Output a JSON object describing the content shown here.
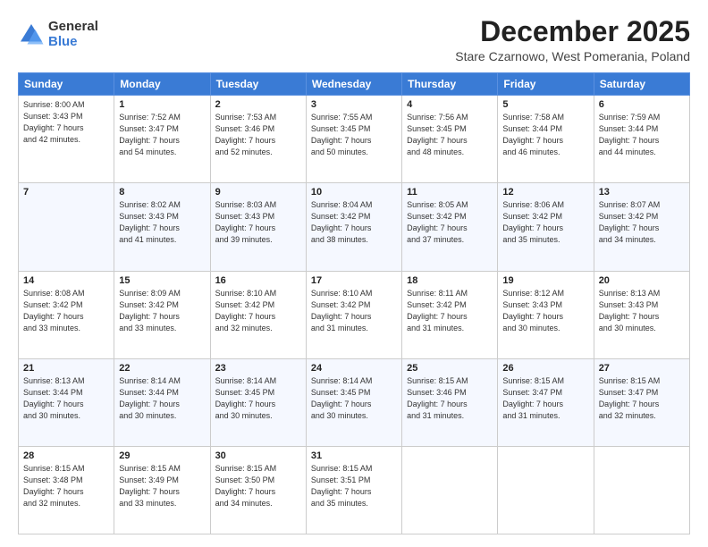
{
  "logo": {
    "general": "General",
    "blue": "Blue"
  },
  "header": {
    "title": "December 2025",
    "subtitle": "Stare Czarnowo, West Pomerania, Poland"
  },
  "weekdays": [
    "Sunday",
    "Monday",
    "Tuesday",
    "Wednesday",
    "Thursday",
    "Friday",
    "Saturday"
  ],
  "weeks": [
    [
      {
        "day": "",
        "info": ""
      },
      {
        "day": "1",
        "info": "Sunrise: 7:52 AM\nSunset: 3:47 PM\nDaylight: 7 hours\nand 54 minutes."
      },
      {
        "day": "2",
        "info": "Sunrise: 7:53 AM\nSunset: 3:46 PM\nDaylight: 7 hours\nand 52 minutes."
      },
      {
        "day": "3",
        "info": "Sunrise: 7:55 AM\nSunset: 3:45 PM\nDaylight: 7 hours\nand 50 minutes."
      },
      {
        "day": "4",
        "info": "Sunrise: 7:56 AM\nSunset: 3:45 PM\nDaylight: 7 hours\nand 48 minutes."
      },
      {
        "day": "5",
        "info": "Sunrise: 7:58 AM\nSunset: 3:44 PM\nDaylight: 7 hours\nand 46 minutes."
      },
      {
        "day": "6",
        "info": "Sunrise: 7:59 AM\nSunset: 3:44 PM\nDaylight: 7 hours\nand 44 minutes."
      }
    ],
    [
      {
        "day": "7",
        "info": ""
      },
      {
        "day": "8",
        "info": "Sunrise: 8:02 AM\nSunset: 3:43 PM\nDaylight: 7 hours\nand 41 minutes."
      },
      {
        "day": "9",
        "info": "Sunrise: 8:03 AM\nSunset: 3:43 PM\nDaylight: 7 hours\nand 39 minutes."
      },
      {
        "day": "10",
        "info": "Sunrise: 8:04 AM\nSunset: 3:42 PM\nDaylight: 7 hours\nand 38 minutes."
      },
      {
        "day": "11",
        "info": "Sunrise: 8:05 AM\nSunset: 3:42 PM\nDaylight: 7 hours\nand 37 minutes."
      },
      {
        "day": "12",
        "info": "Sunrise: 8:06 AM\nSunset: 3:42 PM\nDaylight: 7 hours\nand 35 minutes."
      },
      {
        "day": "13",
        "info": "Sunrise: 8:07 AM\nSunset: 3:42 PM\nDaylight: 7 hours\nand 34 minutes."
      }
    ],
    [
      {
        "day": "14",
        "info": ""
      },
      {
        "day": "15",
        "info": "Sunrise: 8:09 AM\nSunset: 3:42 PM\nDaylight: 7 hours\nand 33 minutes."
      },
      {
        "day": "16",
        "info": "Sunrise: 8:10 AM\nSunset: 3:42 PM\nDaylight: 7 hours\nand 32 minutes."
      },
      {
        "day": "17",
        "info": "Sunrise: 8:10 AM\nSunset: 3:42 PM\nDaylight: 7 hours\nand 31 minutes."
      },
      {
        "day": "18",
        "info": "Sunrise: 8:11 AM\nSunset: 3:42 PM\nDaylight: 7 hours\nand 31 minutes."
      },
      {
        "day": "19",
        "info": "Sunrise: 8:12 AM\nSunset: 3:43 PM\nDaylight: 7 hours\nand 30 minutes."
      },
      {
        "day": "20",
        "info": "Sunrise: 8:13 AM\nSunset: 3:43 PM\nDaylight: 7 hours\nand 30 minutes."
      }
    ],
    [
      {
        "day": "21",
        "info": ""
      },
      {
        "day": "22",
        "info": "Sunrise: 8:14 AM\nSunset: 3:44 PM\nDaylight: 7 hours\nand 30 minutes."
      },
      {
        "day": "23",
        "info": "Sunrise: 8:14 AM\nSunset: 3:45 PM\nDaylight: 7 hours\nand 30 minutes."
      },
      {
        "day": "24",
        "info": "Sunrise: 8:14 AM\nSunset: 3:45 PM\nDaylight: 7 hours\nand 30 minutes."
      },
      {
        "day": "25",
        "info": "Sunrise: 8:15 AM\nSunset: 3:46 PM\nDaylight: 7 hours\nand 31 minutes."
      },
      {
        "day": "26",
        "info": "Sunrise: 8:15 AM\nSunset: 3:47 PM\nDaylight: 7 hours\nand 31 minutes."
      },
      {
        "day": "27",
        "info": "Sunrise: 8:15 AM\nSunset: 3:47 PM\nDaylight: 7 hours\nand 32 minutes."
      }
    ],
    [
      {
        "day": "28",
        "info": "Sunrise: 8:15 AM\nSunset: 3:48 PM\nDaylight: 7 hours\nand 32 minutes."
      },
      {
        "day": "29",
        "info": "Sunrise: 8:15 AM\nSunset: 3:49 PM\nDaylight: 7 hours\nand 33 minutes."
      },
      {
        "day": "30",
        "info": "Sunrise: 8:15 AM\nSunset: 3:50 PM\nDaylight: 7 hours\nand 34 minutes."
      },
      {
        "day": "31",
        "info": "Sunrise: 8:15 AM\nSunset: 3:51 PM\nDaylight: 7 hours\nand 35 minutes."
      },
      {
        "day": "",
        "info": ""
      },
      {
        "day": "",
        "info": ""
      },
      {
        "day": "",
        "info": ""
      }
    ]
  ],
  "week1_sun": "Sunrise: 8:00 AM\nSunset: 3:43 PM\nDaylight: 7 hours\nand 42 minutes.",
  "week3_sun": "Sunrise: 8:08 AM\nSunset: 3:42 PM\nDaylight: 7 hours\nand 33 minutes.",
  "week4_sun": "Sunrise: 8:13 AM\nSunset: 3:44 PM\nDaylight: 7 hours\nand 30 minutes."
}
